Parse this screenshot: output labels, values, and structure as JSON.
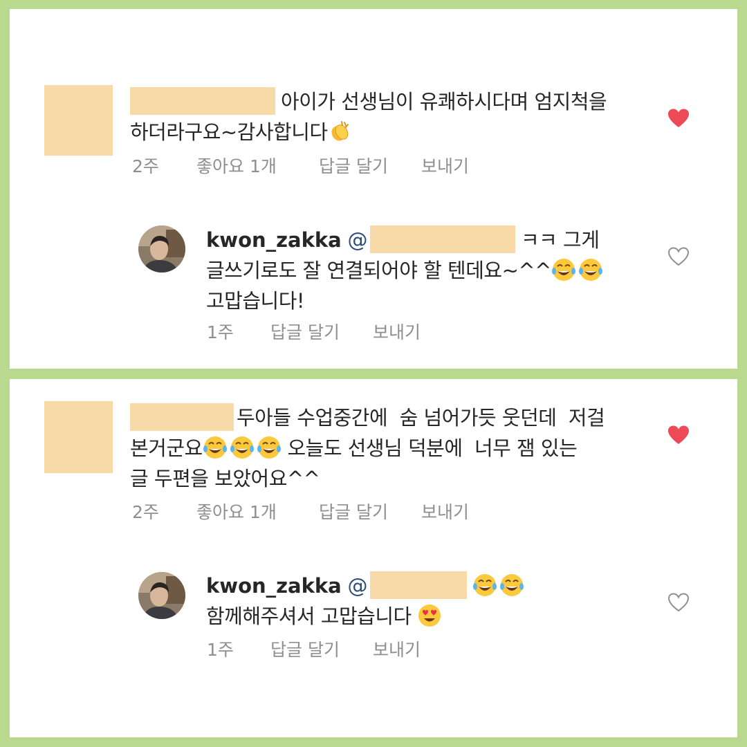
{
  "thread1": {
    "comment": {
      "line1": "아이가 선생님이 유쾌하시다며 엄지척을",
      "line2": "하더라구요~감사합니다",
      "line2_emoji": "clapping-hands-emoji",
      "time": "2주",
      "likes": "좋아요 1개",
      "reply_action": "답글 달기",
      "send_action": "보내기",
      "liked": true
    },
    "reply": {
      "username": "kwon_zakka",
      "at": "@",
      "line1_rest": "ㅋㅋ 그게",
      "line2": "글쓰기로도 잘 연결되어야 할 텐데요~^^",
      "line2_emoji": "tears-of-joy-emoji",
      "line3": "고맙습니다!",
      "time": "1주",
      "reply_action": "답글 달기",
      "send_action": "보내기",
      "liked": false
    }
  },
  "thread2": {
    "comment": {
      "line1": "두아들 수업중간에  숨 넘어가듯 웃던데  저걸",
      "line2_a": "본거군요",
      "line2_b": " 오늘도 선생님 덕분에  너무 잼 있는",
      "line3": "글 두편을 보았어요^^",
      "line2_emoji": "tears-of-joy-emoji",
      "time": "2주",
      "likes": "좋아요 1개",
      "reply_action": "답글 달기",
      "send_action": "보내기",
      "liked": true
    },
    "reply": {
      "username": "kwon_zakka",
      "at": "@",
      "line1_emoji": "tears-of-joy-emoji",
      "line2": "함께해주셔서 고맙습니다 ",
      "line2_emoji": "heart-eyes-emoji",
      "time": "1주",
      "reply_action": "답글 달기",
      "send_action": "보내기",
      "liked": false
    }
  },
  "colors": {
    "frame": "#b9d98e",
    "redaction": "#f8daa9",
    "like_red": "#ed4956",
    "meta_gray": "#8e8e8e",
    "mention_blue": "#2b4d7a"
  }
}
